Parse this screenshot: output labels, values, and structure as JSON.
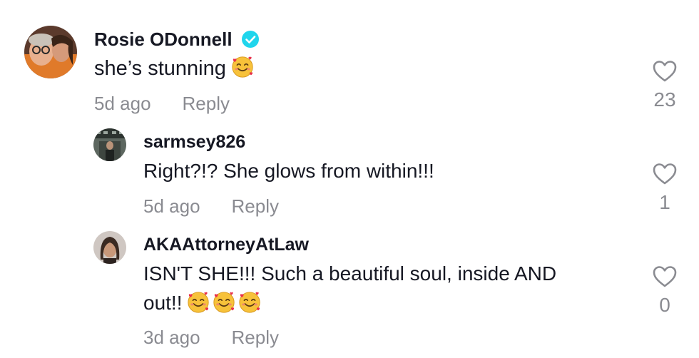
{
  "comments": [
    {
      "username": "Rosie ODonnell",
      "verified": true,
      "text": "she’s stunning",
      "emoji_count": 1,
      "time": "5d ago",
      "reply_label": "Reply",
      "likes": "23"
    },
    {
      "username": "sarmsey826",
      "verified": false,
      "text": "Right?!? She glows from within!!!",
      "emoji_count": 0,
      "time": "5d ago",
      "reply_label": "Reply",
      "likes": "1"
    },
    {
      "username": "AKAAttorneyAtLaw",
      "verified": false,
      "text_line1": "ISN'T SHE!!! Such a beautiful soul, inside AND",
      "text_line2": "out!!",
      "emoji_count": 3,
      "time": "3d ago",
      "reply_label": "Reply",
      "likes": "0"
    }
  ],
  "icons": {
    "verified": "verified-badge-icon",
    "heart": "heart-outline-icon",
    "emoji": "smiling-face-with-hearts-emoji"
  },
  "colors": {
    "text": "#161823",
    "muted": "#8a8b91",
    "verified": "#20d5ec"
  }
}
